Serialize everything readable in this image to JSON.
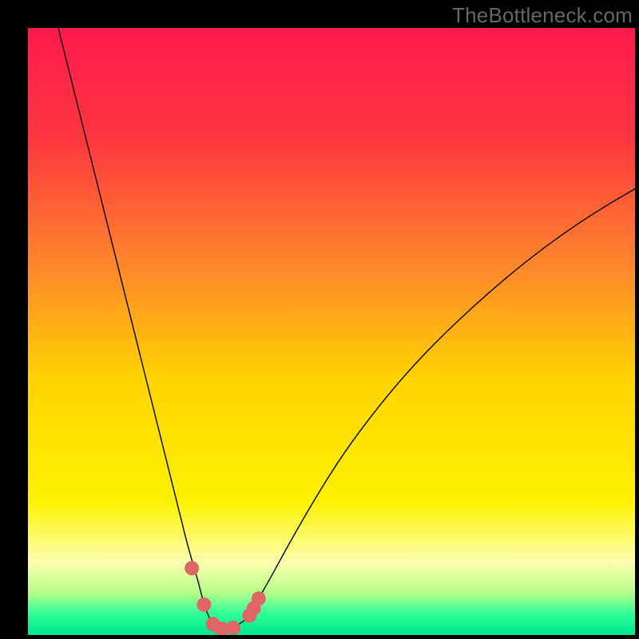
{
  "watermark": "TheBottleneck.com",
  "chart_data": {
    "type": "line",
    "title": "",
    "xlabel": "",
    "ylabel": "",
    "xlim": [
      0,
      100
    ],
    "ylim": [
      0,
      100
    ],
    "grid": false,
    "legend": false,
    "background": {
      "type": "vertical-gradient",
      "stops": [
        {
          "offset": 0.0,
          "color": "#ff1a4d"
        },
        {
          "offset": 0.18,
          "color": "#ff3640"
        },
        {
          "offset": 0.4,
          "color": "#ff8a2a"
        },
        {
          "offset": 0.58,
          "color": "#ffd400"
        },
        {
          "offset": 0.78,
          "color": "#fff200"
        },
        {
          "offset": 0.88,
          "color": "#fcffb0"
        },
        {
          "offset": 0.93,
          "color": "#b6ff8a"
        },
        {
          "offset": 0.965,
          "color": "#2eff99"
        },
        {
          "offset": 1.0,
          "color": "#00e58f"
        }
      ]
    },
    "series": [
      {
        "name": "bottleneck-curve",
        "color": "#000000",
        "stroke_width": 1.4,
        "x": [
          5,
          7,
          9,
          11,
          13,
          15,
          17,
          19,
          21,
          23,
          25,
          26.5,
          28,
          29,
          30,
          30.8,
          31.5,
          32.5,
          34,
          36,
          37,
          38,
          40,
          43,
          47,
          52,
          58,
          64,
          70,
          76,
          82,
          88,
          94,
          100
        ],
        "y": [
          100,
          92,
          84,
          76,
          68,
          60,
          52,
          44,
          36,
          28,
          20,
          14,
          9,
          5,
          2.5,
          1.3,
          1.0,
          1.0,
          1.3,
          2.6,
          4.0,
          6.0,
          9.5,
          15,
          22,
          30,
          38,
          45,
          51,
          56.5,
          61.5,
          66,
          70,
          73.5
        ]
      }
    ],
    "markers": {
      "name": "highlight-points",
      "color": "#e06666",
      "radius": 9,
      "points": [
        {
          "x": 27.0,
          "y": 11.0
        },
        {
          "x": 29.0,
          "y": 5.0
        },
        {
          "x": 30.5,
          "y": 1.8
        },
        {
          "x": 32.0,
          "y": 1.0
        },
        {
          "x": 33.8,
          "y": 1.2
        },
        {
          "x": 36.5,
          "y": 3.2
        },
        {
          "x": 37.2,
          "y": 4.4
        },
        {
          "x": 38.0,
          "y": 6.0
        }
      ]
    },
    "flat_segment": {
      "name": "curve-min-flat",
      "color": "#e06666",
      "stroke_width": 8,
      "x_start": 30.8,
      "x_end": 34.5,
      "y": 1.0
    }
  }
}
